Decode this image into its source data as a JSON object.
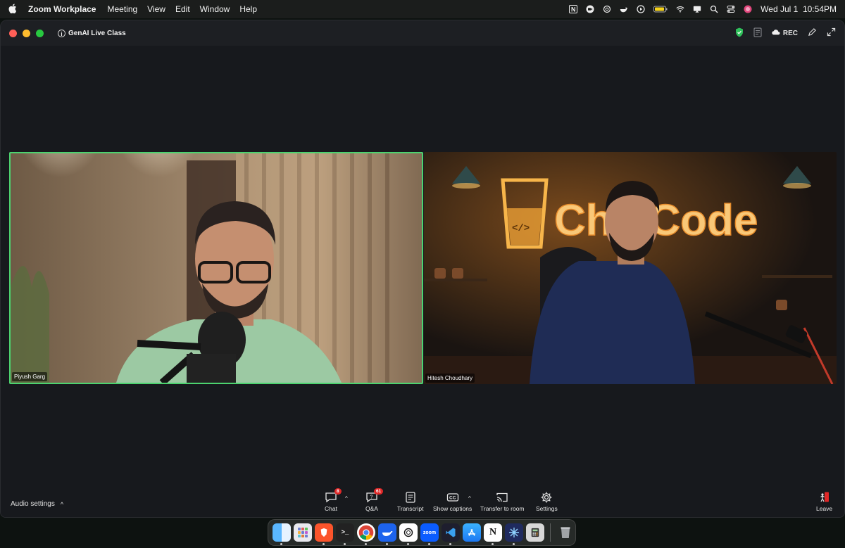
{
  "menubar": {
    "app_name": "Zoom Workplace",
    "menus": [
      "Meeting",
      "View",
      "Edit",
      "Window",
      "Help"
    ],
    "status_icons": [
      "notion-icon",
      "zoom-status-icon",
      "openai-icon",
      "docker-icon",
      "play-icon",
      "battery-icon",
      "wifi-icon",
      "screen-mirroring-icon",
      "search-icon",
      "control-center-icon",
      "siri-icon"
    ],
    "datetime": "Wed Jul 1  10:54PM"
  },
  "window": {
    "meeting_title": "GenAI Live Class",
    "rec_label": "REC"
  },
  "participants": [
    {
      "name": "Piyush Garg",
      "active_speaker": true
    },
    {
      "name": "Hitesh Choudhary",
      "active_speaker": false
    }
  ],
  "background_sign": "ChaiCode",
  "toolbar": {
    "audio_settings": "Audio settings",
    "chat": {
      "label": "Chat",
      "badge": "8"
    },
    "qa": {
      "label": "Q&A",
      "badge": "61"
    },
    "transcript": {
      "label": "Transcript"
    },
    "captions": {
      "label": "Show captions"
    },
    "transfer": {
      "label": "Transfer to room"
    },
    "settings": {
      "label": "Settings"
    },
    "leave": {
      "label": "Leave"
    }
  },
  "dock": {
    "apps": [
      "finder",
      "launchpad",
      "brave",
      "terminal",
      "chrome",
      "docker",
      "chatgpt",
      "zoom",
      "vscode",
      "app-store",
      "notion",
      "perplexity",
      "calculator",
      "trash"
    ],
    "zoom_label": "zoom"
  },
  "colors": {
    "active_speaker_border": "#4cd36f",
    "badge": "#e02828",
    "leave_icon": "#e02828"
  }
}
